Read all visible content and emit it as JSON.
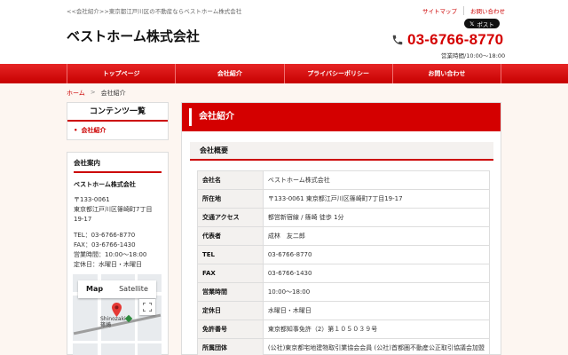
{
  "header": {
    "description": "<<会社紹介>>東京都江戸川区の不動産ならベストホーム株式会社",
    "links": [
      "サイトマップ",
      "お問い合わせ"
    ],
    "post_button": "ポスト",
    "site_title": "ベストホーム株式会社",
    "phone": "03-6766-8770",
    "hours": "営業時間/10:00〜18:00"
  },
  "nav": {
    "items": [
      "トップページ",
      "会社紹介",
      "プライバシーポリシー",
      "お問い合わせ"
    ]
  },
  "breadcrumb": {
    "home": "ホーム",
    "separator": ">",
    "current": "会社紹介"
  },
  "sidebar": {
    "contents_title": "コンテンツ一覧",
    "contents_link": "会社紹介",
    "company": {
      "title": "会社案内",
      "name": "ベストホーム株式会社",
      "postal": "〒133-0061",
      "address": "東京都江戸川区篠崎町7丁目19-17",
      "tel": "TEL：03-6766-8770",
      "fax": "FAX：03-6766-1430",
      "hours": "営業時間：10:00〜18:00",
      "holiday": "定休日：水曜日・木曜日"
    },
    "map": {
      "tab_map": "Map",
      "tab_satellite": "Satellite",
      "station_en": "Shinozaki",
      "station_jp": "篠崎"
    }
  },
  "main": {
    "title": "会社紹介",
    "section": "会社概要",
    "table": [
      {
        "label": "会社名",
        "value": "ベストホーム株式会社"
      },
      {
        "label": "所在地",
        "value": "〒133-0061 東京都江戸川区篠崎町7丁目19-17"
      },
      {
        "label": "交通アクセス",
        "value": "都営新宿線 / 篠崎 徒歩 1分"
      },
      {
        "label": "代表者",
        "value": "成林　友二郎"
      },
      {
        "label": "TEL",
        "value": "03-6766-8770"
      },
      {
        "label": "FAX",
        "value": "03-6766-1430"
      },
      {
        "label": "営業時間",
        "value": "10:00〜18:00"
      },
      {
        "label": "定休日",
        "value": "水曜日・木曜日"
      },
      {
        "label": "免許番号",
        "value": "東京都知事免許（2）第１０５０３９号"
      },
      {
        "label": "所属団体",
        "value": "(公社)東京都宅地建物取引業協会会員 (公社)首都圏不動産公正取引協議会加盟"
      }
    ]
  },
  "colors": {
    "accent": "#d40000",
    "background": "#fdf6f1"
  }
}
